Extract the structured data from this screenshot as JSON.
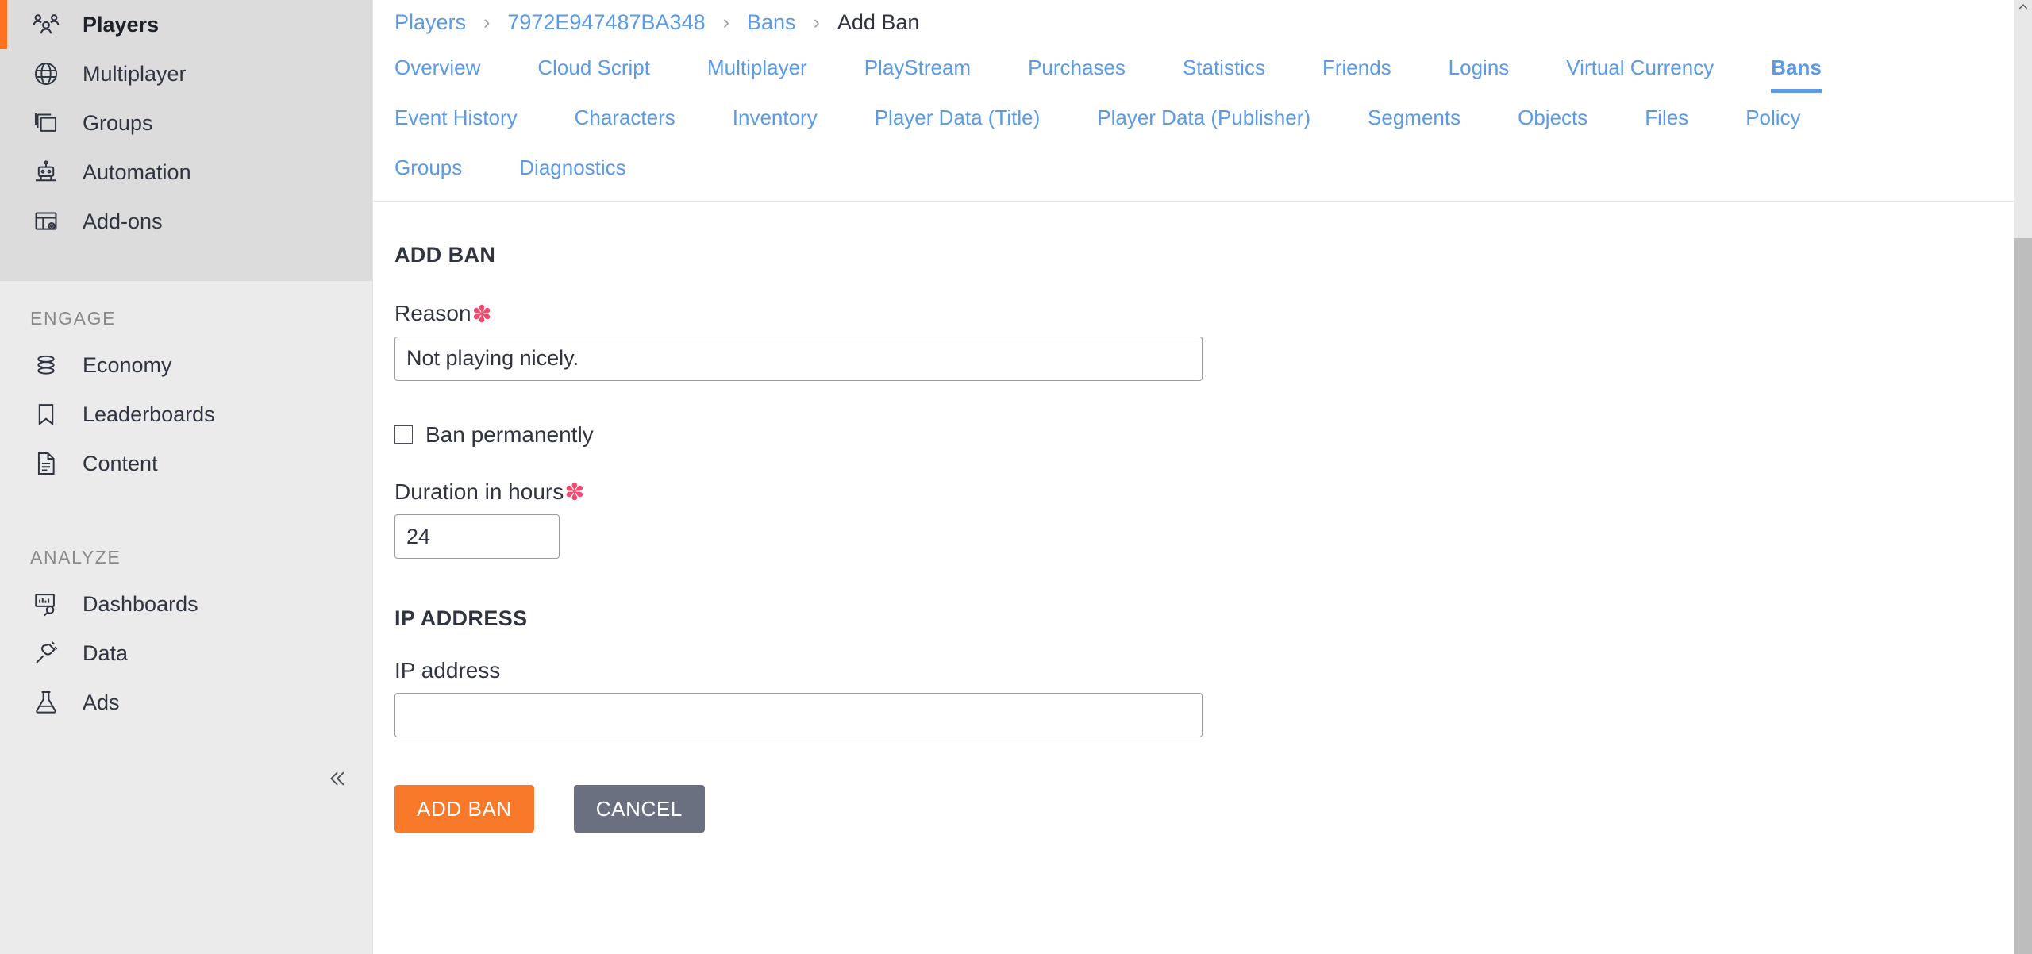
{
  "sidebar": {
    "groups": [
      {
        "label": "",
        "shaded": true,
        "items": [
          {
            "label": "Players",
            "icon": "players-icon",
            "active": true
          },
          {
            "label": "Multiplayer",
            "icon": "globe-icon",
            "active": false
          },
          {
            "label": "Groups",
            "icon": "layers-icon",
            "active": false
          },
          {
            "label": "Automation",
            "icon": "robot-icon",
            "active": false
          },
          {
            "label": "Add-ons",
            "icon": "addons-icon",
            "active": false
          }
        ]
      },
      {
        "label": "ENGAGE",
        "shaded": false,
        "items": [
          {
            "label": "Economy",
            "icon": "coins-icon",
            "active": false
          },
          {
            "label": "Leaderboards",
            "icon": "bookmark-icon",
            "active": false
          },
          {
            "label": "Content",
            "icon": "document-icon",
            "active": false
          }
        ]
      },
      {
        "label": "ANALYZE",
        "shaded": false,
        "items": [
          {
            "label": "Dashboards",
            "icon": "dashboard-search-icon",
            "active": false
          },
          {
            "label": "Data",
            "icon": "plug-icon",
            "active": false
          },
          {
            "label": "Ads",
            "icon": "flask-icon",
            "active": false
          }
        ]
      }
    ],
    "collapse_icon": "chevron-double-left-icon"
  },
  "breadcrumb": {
    "separator": "›",
    "items": [
      {
        "label": "Players",
        "current": false
      },
      {
        "label": "7972E947487BA348",
        "current": false
      },
      {
        "label": "Bans",
        "current": false
      },
      {
        "label": "Add Ban",
        "current": true
      }
    ]
  },
  "tabs": {
    "rows": [
      [
        {
          "label": "Overview",
          "active": false
        },
        {
          "label": "Cloud Script",
          "active": false
        },
        {
          "label": "Multiplayer",
          "active": false
        },
        {
          "label": "PlayStream",
          "active": false
        },
        {
          "label": "Purchases",
          "active": false
        },
        {
          "label": "Statistics",
          "active": false
        },
        {
          "label": "Friends",
          "active": false
        },
        {
          "label": "Logins",
          "active": false
        },
        {
          "label": "Virtual Currency",
          "active": false
        },
        {
          "label": "Bans",
          "active": true
        }
      ],
      [
        {
          "label": "Event History",
          "active": false
        },
        {
          "label": "Characters",
          "active": false
        },
        {
          "label": "Inventory",
          "active": false
        },
        {
          "label": "Player Data (Title)",
          "active": false
        },
        {
          "label": "Player Data (Publisher)",
          "active": false
        },
        {
          "label": "Segments",
          "active": false
        },
        {
          "label": "Objects",
          "active": false
        },
        {
          "label": "Files",
          "active": false
        },
        {
          "label": "Policy",
          "active": false
        }
      ],
      [
        {
          "label": "Groups",
          "active": false
        },
        {
          "label": "Diagnostics",
          "active": false
        }
      ]
    ]
  },
  "form": {
    "heading": "ADD BAN",
    "reason": {
      "label": "Reason",
      "required_marker": "✽",
      "value": "Not playing nicely.",
      "placeholder": ""
    },
    "ban_permanently": {
      "label": "Ban permanently",
      "checked": false
    },
    "duration": {
      "label": "Duration in hours",
      "required_marker": "✽",
      "value": "24",
      "placeholder": ""
    },
    "ip_section": {
      "heading": "IP ADDRESS",
      "label": "IP address",
      "value": "",
      "placeholder": ""
    },
    "buttons": {
      "submit": "ADD BAN",
      "cancel": "CANCEL"
    }
  },
  "colors": {
    "accent_orange": "#f9792a",
    "link_blue": "#5a9ae6",
    "required_red": "#f4496d",
    "cancel_gray": "#6b7080",
    "sidebar_bg": "#ebebeb",
    "sidebar_shaded": "#dcdcdc"
  },
  "scrollbar": {
    "up_arrow_icon": "chevron-up-icon"
  }
}
